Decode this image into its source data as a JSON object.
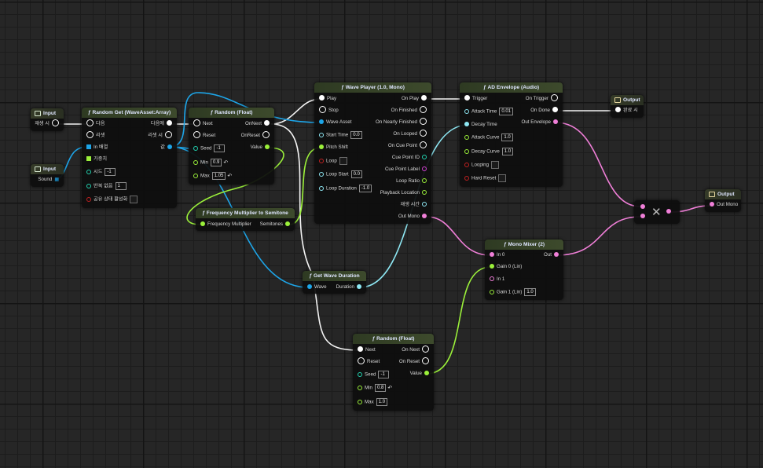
{
  "input1": {
    "title": "Input",
    "pin": "재생 시"
  },
  "input2": {
    "title": "Input",
    "pin": "Sound"
  },
  "randomGet": {
    "title": "Random Get (WaveAsset:Array)",
    "next": "다음",
    "reset": "리셋",
    "in_array": "In 배열",
    "weight": "가중치",
    "seed_label": "시드",
    "seed_value": "-1",
    "no_repeat_label": "반복 없음",
    "no_repeat_value": "1",
    "shared_state": "공유 상태 활성화",
    "out_next": "다음에",
    "out_reset": "리셋 시",
    "out_value": "값"
  },
  "random1": {
    "title": "Random (Float)",
    "next": "Next",
    "reset": "Reset",
    "seed_label": "Seed",
    "seed_value": "-1",
    "min_label": "Min",
    "min_value": "0.9",
    "max_label": "Max",
    "max_value": "1.05",
    "on_next": "OnNext",
    "on_reset": "OnReset",
    "value": "Value"
  },
  "freq": {
    "title": "Frequency Multiplier to Semitone",
    "in": "Frequency Multiplier",
    "out": "Semitones"
  },
  "wave": {
    "title": "Wave Player (1.0, Mono)",
    "play": "Play",
    "stop": "Stop",
    "asset": "Wave Asset",
    "start_label": "Start Time",
    "start_value": "0.0",
    "pitch": "Pitch Shift",
    "loop": "Loop",
    "loop_start_label": "Loop Start",
    "loop_start_value": "0.0",
    "loop_dur_label": "Loop Duration",
    "loop_dur_value": "-1.0",
    "on_play": "On Play",
    "on_finished": "On Finished",
    "on_nearly": "On Nearly Finished",
    "on_looped": "On Looped",
    "on_cue": "On Cue Point",
    "cue_id": "Cue Point ID",
    "cue_label": "Cue Point Label",
    "loop_ratio": "Loop Ratio",
    "playback": "Playback Location",
    "play_time": "재생 시간",
    "out_mono": "Out Mono"
  },
  "ad": {
    "title": "AD Envelope (Audio)",
    "trigger": "Trigger",
    "attack_label": "Attack Time",
    "attack_value": "0.01",
    "decay_time": "Decay Time",
    "attack_curve_label": "Attack Curve",
    "attack_curve_value": "1.0",
    "decay_curve_label": "Decay Curve",
    "decay_curve_value": "1.0",
    "looping": "Looping",
    "hard_reset": "Hard Reset",
    "on_trigger": "On Trigger",
    "on_done": "On Done",
    "out_env": "Out Envelope"
  },
  "output1": {
    "title": "Output",
    "pin": "완료 시"
  },
  "output2": {
    "title": "Output",
    "pin": "Out Mono"
  },
  "getDur": {
    "title": "Get Wave Duration",
    "in": "Wave",
    "out": "Duration"
  },
  "mixer": {
    "title": "Mono Mixer (2)",
    "in0": "In 0",
    "gain0": "Gain 0 (Lin)",
    "in1": "In 1",
    "gain1_label": "Gain 1 (Lin)",
    "gain1_value": "1.0",
    "out": "Out"
  },
  "random2": {
    "title": "Random (Float)",
    "next": "Next",
    "reset": "Reset",
    "seed_label": "Seed",
    "seed_value": "-1",
    "min_label": "Min",
    "min_value": "0.8",
    "max_label": "Max",
    "max_value": "1.0",
    "on_next": "On Next",
    "on_reset": "On Reset",
    "value": "Value"
  },
  "multiply": {
    "symbol": "✕"
  },
  "colors": {
    "exec": "#ffffff",
    "audio": "#f07fd8",
    "float": "#9bf03a",
    "wave_asset": "#1da5e8",
    "time": "#8ee8f4",
    "background": "#262626"
  }
}
